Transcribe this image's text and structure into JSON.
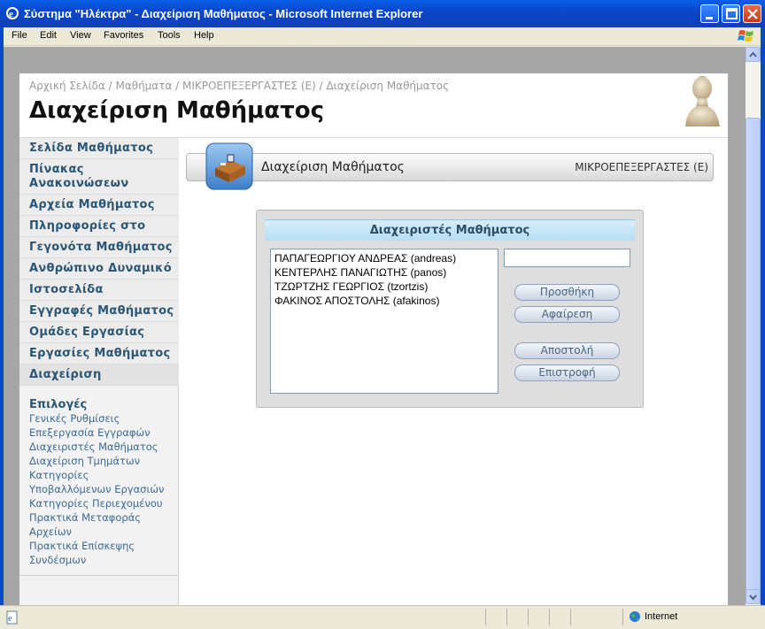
{
  "window": {
    "title": "Σύστημα \"Ηλέκτρα\" - Διαχείριση Μαθήματος - Microsoft Internet Explorer"
  },
  "menu": [
    "File",
    "Edit",
    "View",
    "Favorites",
    "Tools",
    "Help"
  ],
  "page": {
    "breadcrumb": "Αρχική Σελίδα / Μαθήματα / ΜΙΚΡΟΕΠΕΞΕΡΓΑΣΤΕΣ (Ε) / Διαχείριση Μαθήματος",
    "title": "Διαχείριση Μαθήματος"
  },
  "sidebar": {
    "items": [
      "Σελίδα Μαθήματος",
      "Πίνακας Ανακοινώσεων",
      "Αρχεία Μαθήματος",
      "Πληροφορίες στο Web",
      "Γεγονότα Μαθήματος",
      "Ανθρώπινο Δυναμικό",
      "Ιστοσελίδα Μαθήματος",
      "Εγγραφές Μαθήματος",
      "Ομάδες Εργασίας",
      "Εργασίες Μαθήματος",
      "Διαχείριση"
    ],
    "options_title": "Επιλογές",
    "options": [
      "Γενικές Ρυθμίσεις",
      "Επεξεργασία Εγγραφών",
      "Διαχειριστές Μαθήματος",
      "Διαχείριση Τμημάτων",
      "Κατηγορίες",
      "Υποβαλλόμενων Εργασιών",
      "Κατηγορίες Περιεχομένου",
      "Πρακτικά Μεταφοράς",
      "Αρχείων",
      "Πρακτικά Επίσκεψης",
      "Συνδέσμων"
    ]
  },
  "main": {
    "header_label": "Διαχείριση Μαθήματος",
    "course_name": "ΜΙΚΡΟΕΠΕΞΕΡΓΑΣΤΕΣ (Ε)",
    "panel": {
      "title": "Διαχειριστές Μαθήματος",
      "admins": [
        "ΠΑΠΑΓΕΩΡΓΙΟΥ ΑΝΔΡΕΑΣ (andreas)",
        "ΚΕΝΤΕΡΛΗΣ ΠΑΝΑΓΙΩΤΗΣ (panos)",
        "ΤΖΩΡΤΖΗΣ ΓΕΩΡΓΙΟΣ (tzortzis)",
        "ΦΑΚΙΝΟΣ ΑΠΟΣΤΟΛΗΣ (afakinos)"
      ],
      "input_value": "",
      "buttons": {
        "add": "Προσθήκη",
        "remove": "Αφαίρεση",
        "send": "Αποστολή",
        "back": "Επιστροφή"
      }
    }
  },
  "status": {
    "zone": "Internet"
  },
  "colors": {
    "titlebar": "#0a47c9",
    "nav_text": "#2b5675",
    "panel_head": "#b6def3"
  }
}
